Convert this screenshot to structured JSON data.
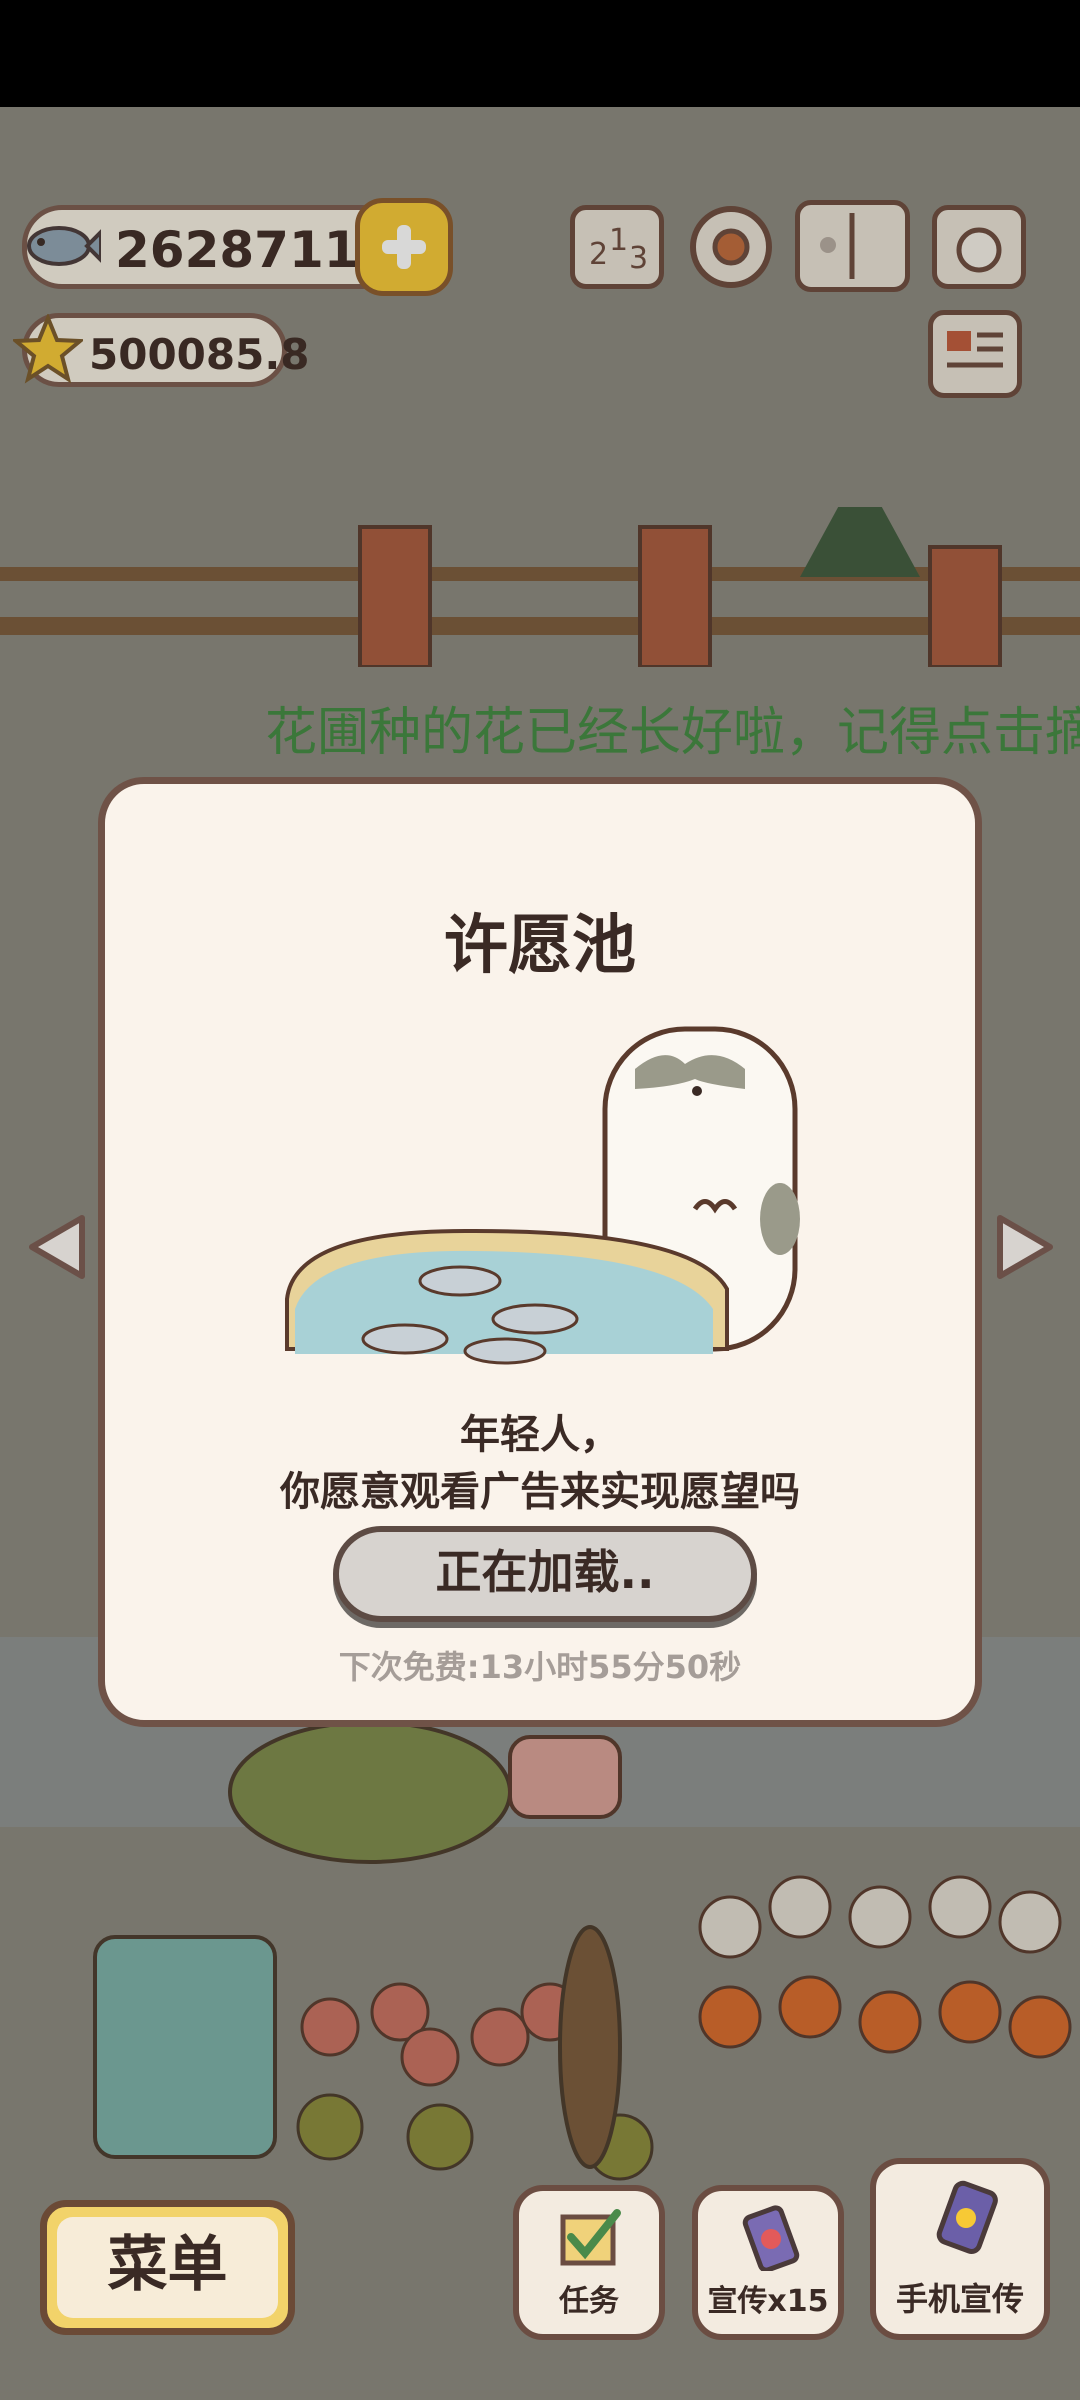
{
  "hud": {
    "fish_count": "2628711",
    "star_count": "500085.8"
  },
  "banner": {
    "text": "花圃种的花已经长好啦，记得点击摘"
  },
  "dialog": {
    "title": "许愿池",
    "message_line1": "年轻人，",
    "message_line2": "你愿意观看广告来实现愿望吗",
    "loading_button": "正在加载..",
    "next_free": "下次免费:13小时55分50秒"
  },
  "bottom": {
    "menu_label": "菜单",
    "task_label": "任务",
    "promote_label": "宣传x15",
    "phone_promote_label": "手机宣传"
  },
  "colors": {
    "dialog_bg": "#faf3eb",
    "dialog_border": "#6f5247",
    "banner_text": "#3d8a3d",
    "plus_button": "#f7c935"
  }
}
